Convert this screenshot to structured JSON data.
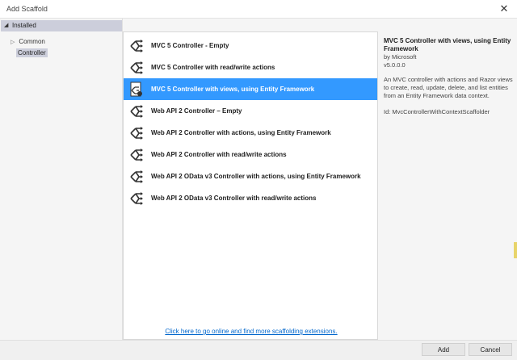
{
  "window": {
    "title": "Add Scaffold",
    "close_glyph": "✕"
  },
  "sidebar": {
    "header": "Installed",
    "items": [
      {
        "label": "Common",
        "expanded": false
      },
      {
        "label": "Controller",
        "selected": true
      }
    ]
  },
  "list": {
    "items": [
      {
        "label": "MVC 5 Controller - Empty",
        "icon": "scaffold-controller-icon",
        "selected": false
      },
      {
        "label": "MVC 5 Controller with read/write actions",
        "icon": "scaffold-controller-icon",
        "selected": false
      },
      {
        "label": "MVC 5 Controller with views, using Entity Framework",
        "icon": "scaffold-controller-views-icon",
        "selected": true
      },
      {
        "label": "Web API 2 Controller – Empty",
        "icon": "scaffold-controller-icon",
        "selected": false
      },
      {
        "label": "Web API 2 Controller with actions, using Entity Framework",
        "icon": "scaffold-controller-icon",
        "selected": false
      },
      {
        "label": "Web API 2 Controller with read/write actions",
        "icon": "scaffold-controller-icon",
        "selected": false
      },
      {
        "label": "Web API 2 OData v3 Controller with actions, using Entity Framework",
        "icon": "scaffold-controller-icon",
        "selected": false
      },
      {
        "label": "Web API 2 OData v3 Controller with read/write actions",
        "icon": "scaffold-controller-icon",
        "selected": false
      }
    ],
    "online_link": "Click here to go online and find more scaffolding extensions."
  },
  "details": {
    "title": "MVC 5 Controller with views, using Entity Framework",
    "author": "by Microsoft",
    "version": "v5.0.0.0",
    "description": "An MVC controller with actions and Razor views to create, read, update, delete, and list entities from an Entity Framework data context.",
    "id": "Id: MvcControllerWithContextScaffolder"
  },
  "footer": {
    "add_label": "Add",
    "cancel_label": "Cancel"
  },
  "colors": {
    "selection": "#3399ff",
    "link": "#0066cc",
    "sidebar_selected": "#cccedb"
  }
}
